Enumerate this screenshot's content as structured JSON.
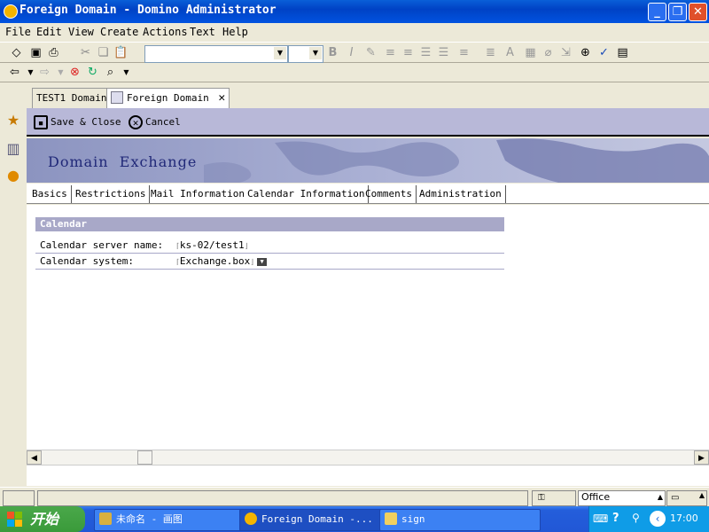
{
  "window": {
    "title": "Foreign Domain - Domino Administrator"
  },
  "menu": [
    "File",
    "Edit",
    "View",
    "Create",
    "Actions",
    "Text",
    "Help"
  ],
  "window_tabs": [
    "TEST1 Domain",
    "Foreign Domain"
  ],
  "actions": {
    "save_close": "Save & Close",
    "cancel": "Cancel"
  },
  "banner": {
    "title": "Domain  Exchange"
  },
  "doc_tabs": [
    "Basics",
    "Restrictions",
    "Mail Information",
    "Calendar Information",
    "Comments",
    "Administration"
  ],
  "active_doc_tab": "Calendar Information",
  "section": {
    "title": "Calendar",
    "fields": [
      {
        "label": "Calendar server name:",
        "value": "ks-02/test1"
      },
      {
        "label": "Calendar system:",
        "value": "Exchange.box"
      }
    ]
  },
  "status": {
    "location": "Office"
  },
  "taskbar": {
    "start": "开始",
    "tasks": [
      "未命名 - 画图",
      "Foreign Domain -...",
      "sign"
    ],
    "clock": "17:00"
  },
  "colors": {
    "titlebar": "#0042c5",
    "action_bar": "#b8b8d8",
    "section_header": "#a8a8c8",
    "taskbar": "#245edb"
  }
}
